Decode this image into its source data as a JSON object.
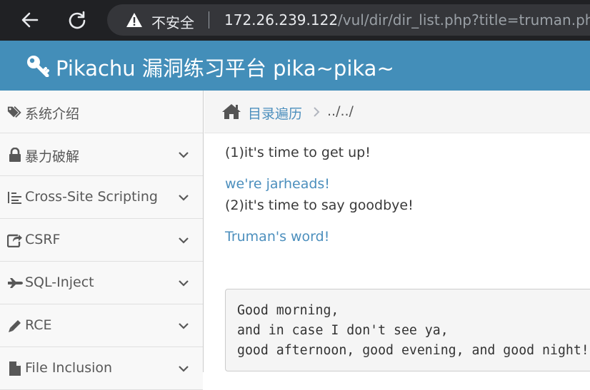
{
  "browser": {
    "security_label": "不安全",
    "url_host": "172.26.239.122",
    "url_path": "/vul/dir/dir_list.php?title=truman.php",
    "icons": {
      "back": "arrow-left-icon",
      "reload": "reload-icon",
      "warning": "warning-triangle-icon"
    }
  },
  "header": {
    "title": "Pikachu 漏洞练习平台 pika~pika~",
    "icon": "key-icon",
    "background": "#438eb9"
  },
  "sidebar": {
    "items": [
      {
        "label": "系统介绍",
        "icon": "tags-icon",
        "has_submenu": false
      },
      {
        "label": "暴力破解",
        "icon": "lock-icon",
        "has_submenu": true
      },
      {
        "label": "Cross-Site Scripting",
        "icon": "list-indent-icon",
        "has_submenu": true
      },
      {
        "label": "CSRF",
        "icon": "share-icon",
        "has_submenu": true
      },
      {
        "label": "SQL-Inject",
        "icon": "fighter-jet-icon",
        "has_submenu": true
      },
      {
        "label": "RCE",
        "icon": "pencil-icon",
        "has_submenu": true
      },
      {
        "label": "File Inclusion",
        "icon": "file-icon",
        "has_submenu": true
      }
    ]
  },
  "breadcrumb": {
    "home_icon": "home-icon",
    "link": "目录遍历",
    "current": "../../"
  },
  "content": {
    "line1": "(1)it's time to get up!",
    "link1": "we're jarheads!",
    "line2": "(2)it's time to say goodbye!",
    "link2": "Truman's word!",
    "code_lines": [
      "Good morning,",
      "and in case I don't see ya,",
      "good afternoon, good evening, and good night!"
    ]
  },
  "colors": {
    "link": "#4c8fbd",
    "chrome": "#202124",
    "omnibox": "#35363a"
  }
}
